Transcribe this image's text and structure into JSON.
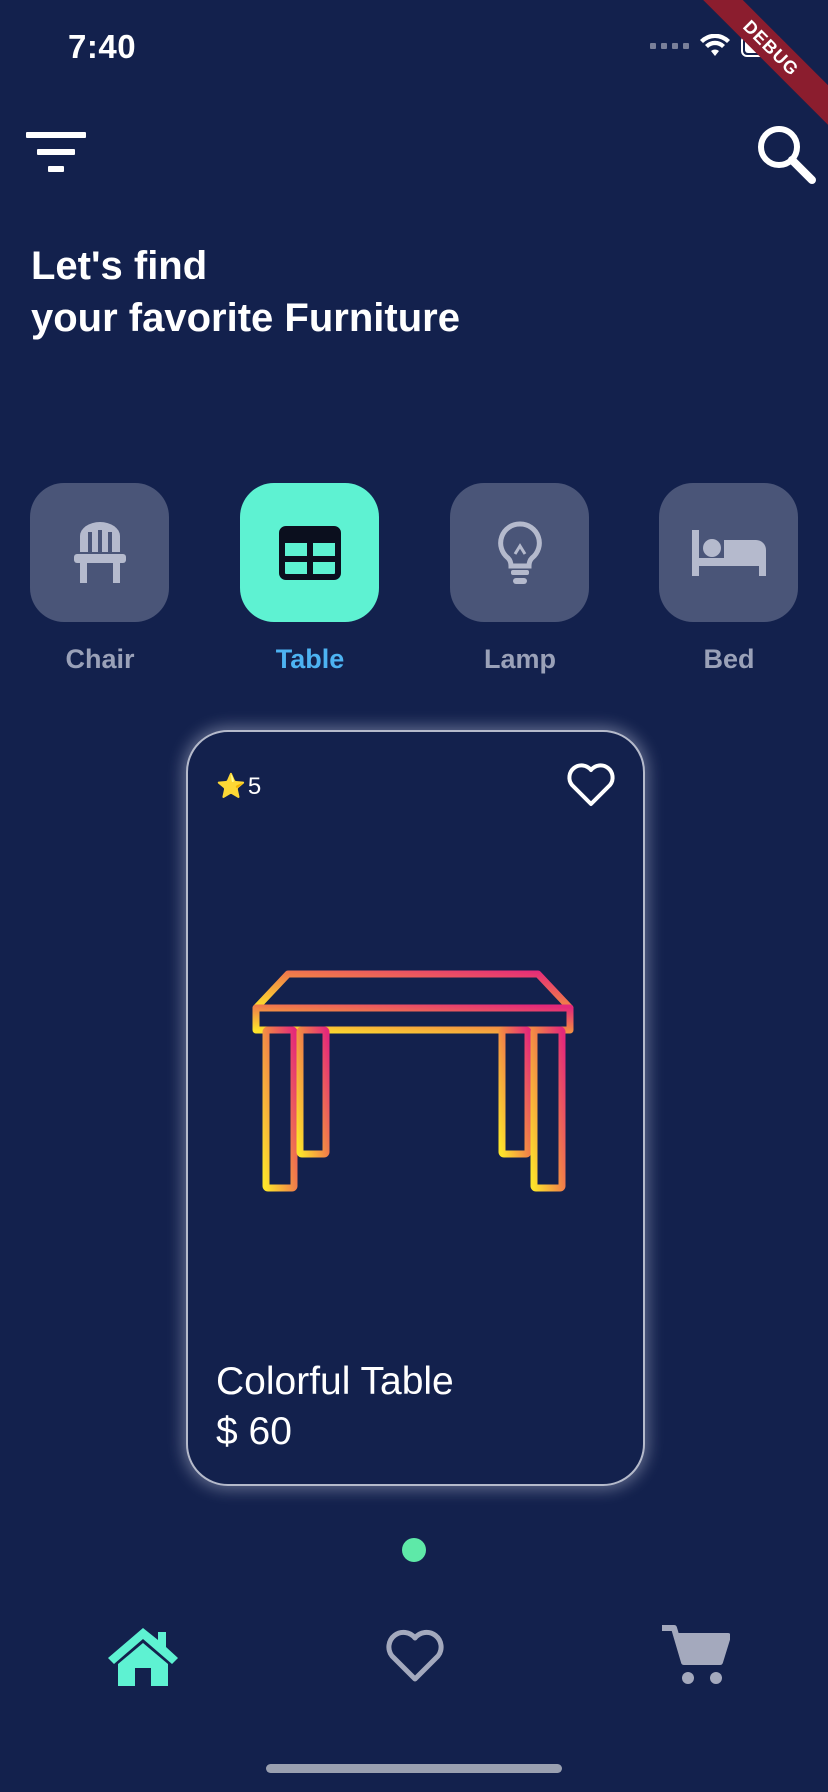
{
  "status_bar": {
    "time": "7:40",
    "debug_label": "DEBUG"
  },
  "header": {
    "menu_icon": "filter-menu-icon",
    "search_icon": "search-icon"
  },
  "headline": {
    "line1": "Let's find",
    "line2": "your favorite Furniture"
  },
  "categories": [
    {
      "label": "Chair",
      "icon": "chair-icon",
      "active": false
    },
    {
      "label": "Table",
      "icon": "table-icon",
      "active": true
    },
    {
      "label": "Lamp",
      "icon": "lamp-icon",
      "active": false
    },
    {
      "label": "Bed",
      "icon": "bed-icon",
      "active": false
    }
  ],
  "product": {
    "rating_icon": "⭐",
    "rating": "5",
    "name": "Colorful Table",
    "price": "$ 60"
  },
  "pager": {
    "count": 1,
    "active_index": 0
  },
  "bottom_nav": {
    "items": [
      {
        "icon": "home-icon",
        "active": true
      },
      {
        "icon": "heart-icon",
        "active": false
      },
      {
        "icon": "cart-icon",
        "active": false
      }
    ]
  },
  "colors": {
    "background": "#13214d",
    "accent": "#5ef2d2",
    "active_label": "#4db3f2",
    "inactive_tile": "#4a5578",
    "page_dot": "#5ee9a8"
  }
}
